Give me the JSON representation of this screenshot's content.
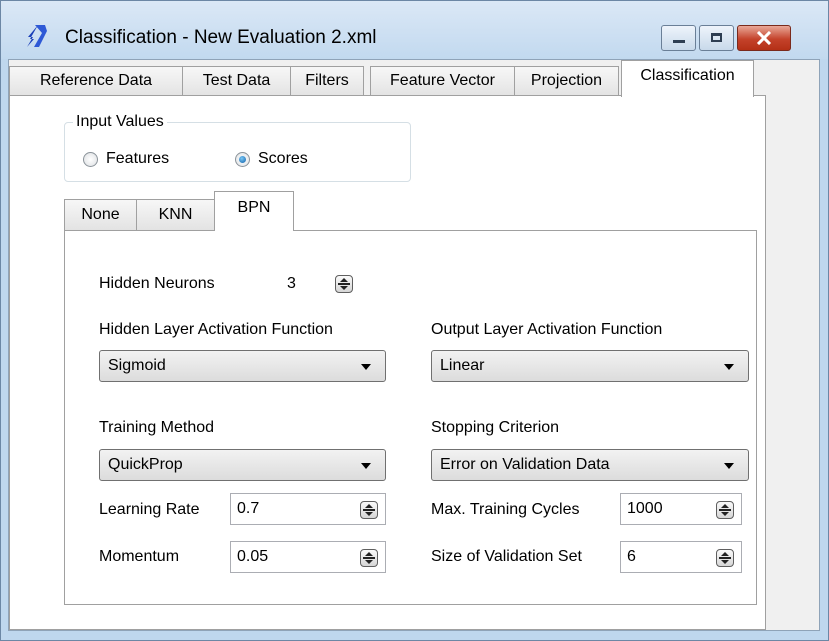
{
  "window": {
    "title": "Classification - New Evaluation 2.xml"
  },
  "main_tabs": [
    "Reference Data",
    "Test Data",
    "Filters",
    "Feature Vector",
    "Projection",
    "Classification"
  ],
  "input_values": {
    "legend": "Input Values",
    "options": [
      "Features",
      "Scores"
    ],
    "selected": "Scores"
  },
  "classifier_tabs": [
    "None",
    "KNN",
    "BPN"
  ],
  "bpn": {
    "hidden_neurons": {
      "label": "Hidden Neurons",
      "value": "3"
    },
    "hidden_activation": {
      "label": "Hidden Layer Activation Function",
      "value": "Sigmoid"
    },
    "output_activation": {
      "label": "Output Layer Activation Function",
      "value": "Linear"
    },
    "training_method": {
      "label": "Training Method",
      "value": "QuickProp"
    },
    "stopping_criterion": {
      "label": "Stopping Criterion",
      "value": "Error on Validation Data"
    },
    "learning_rate": {
      "label": "Learning Rate",
      "value": "0.7"
    },
    "momentum": {
      "label": "Momentum",
      "value": "0.05"
    },
    "max_training_cycles": {
      "label": "Max. Training Cycles",
      "value": "1000"
    },
    "validation_set_size": {
      "label": "Size of Validation Set",
      "value": "6"
    }
  },
  "colors": {
    "window_frame": "#bfd7ee",
    "close_button": "#c4422b",
    "radio_selected": "#0f5fa9"
  }
}
